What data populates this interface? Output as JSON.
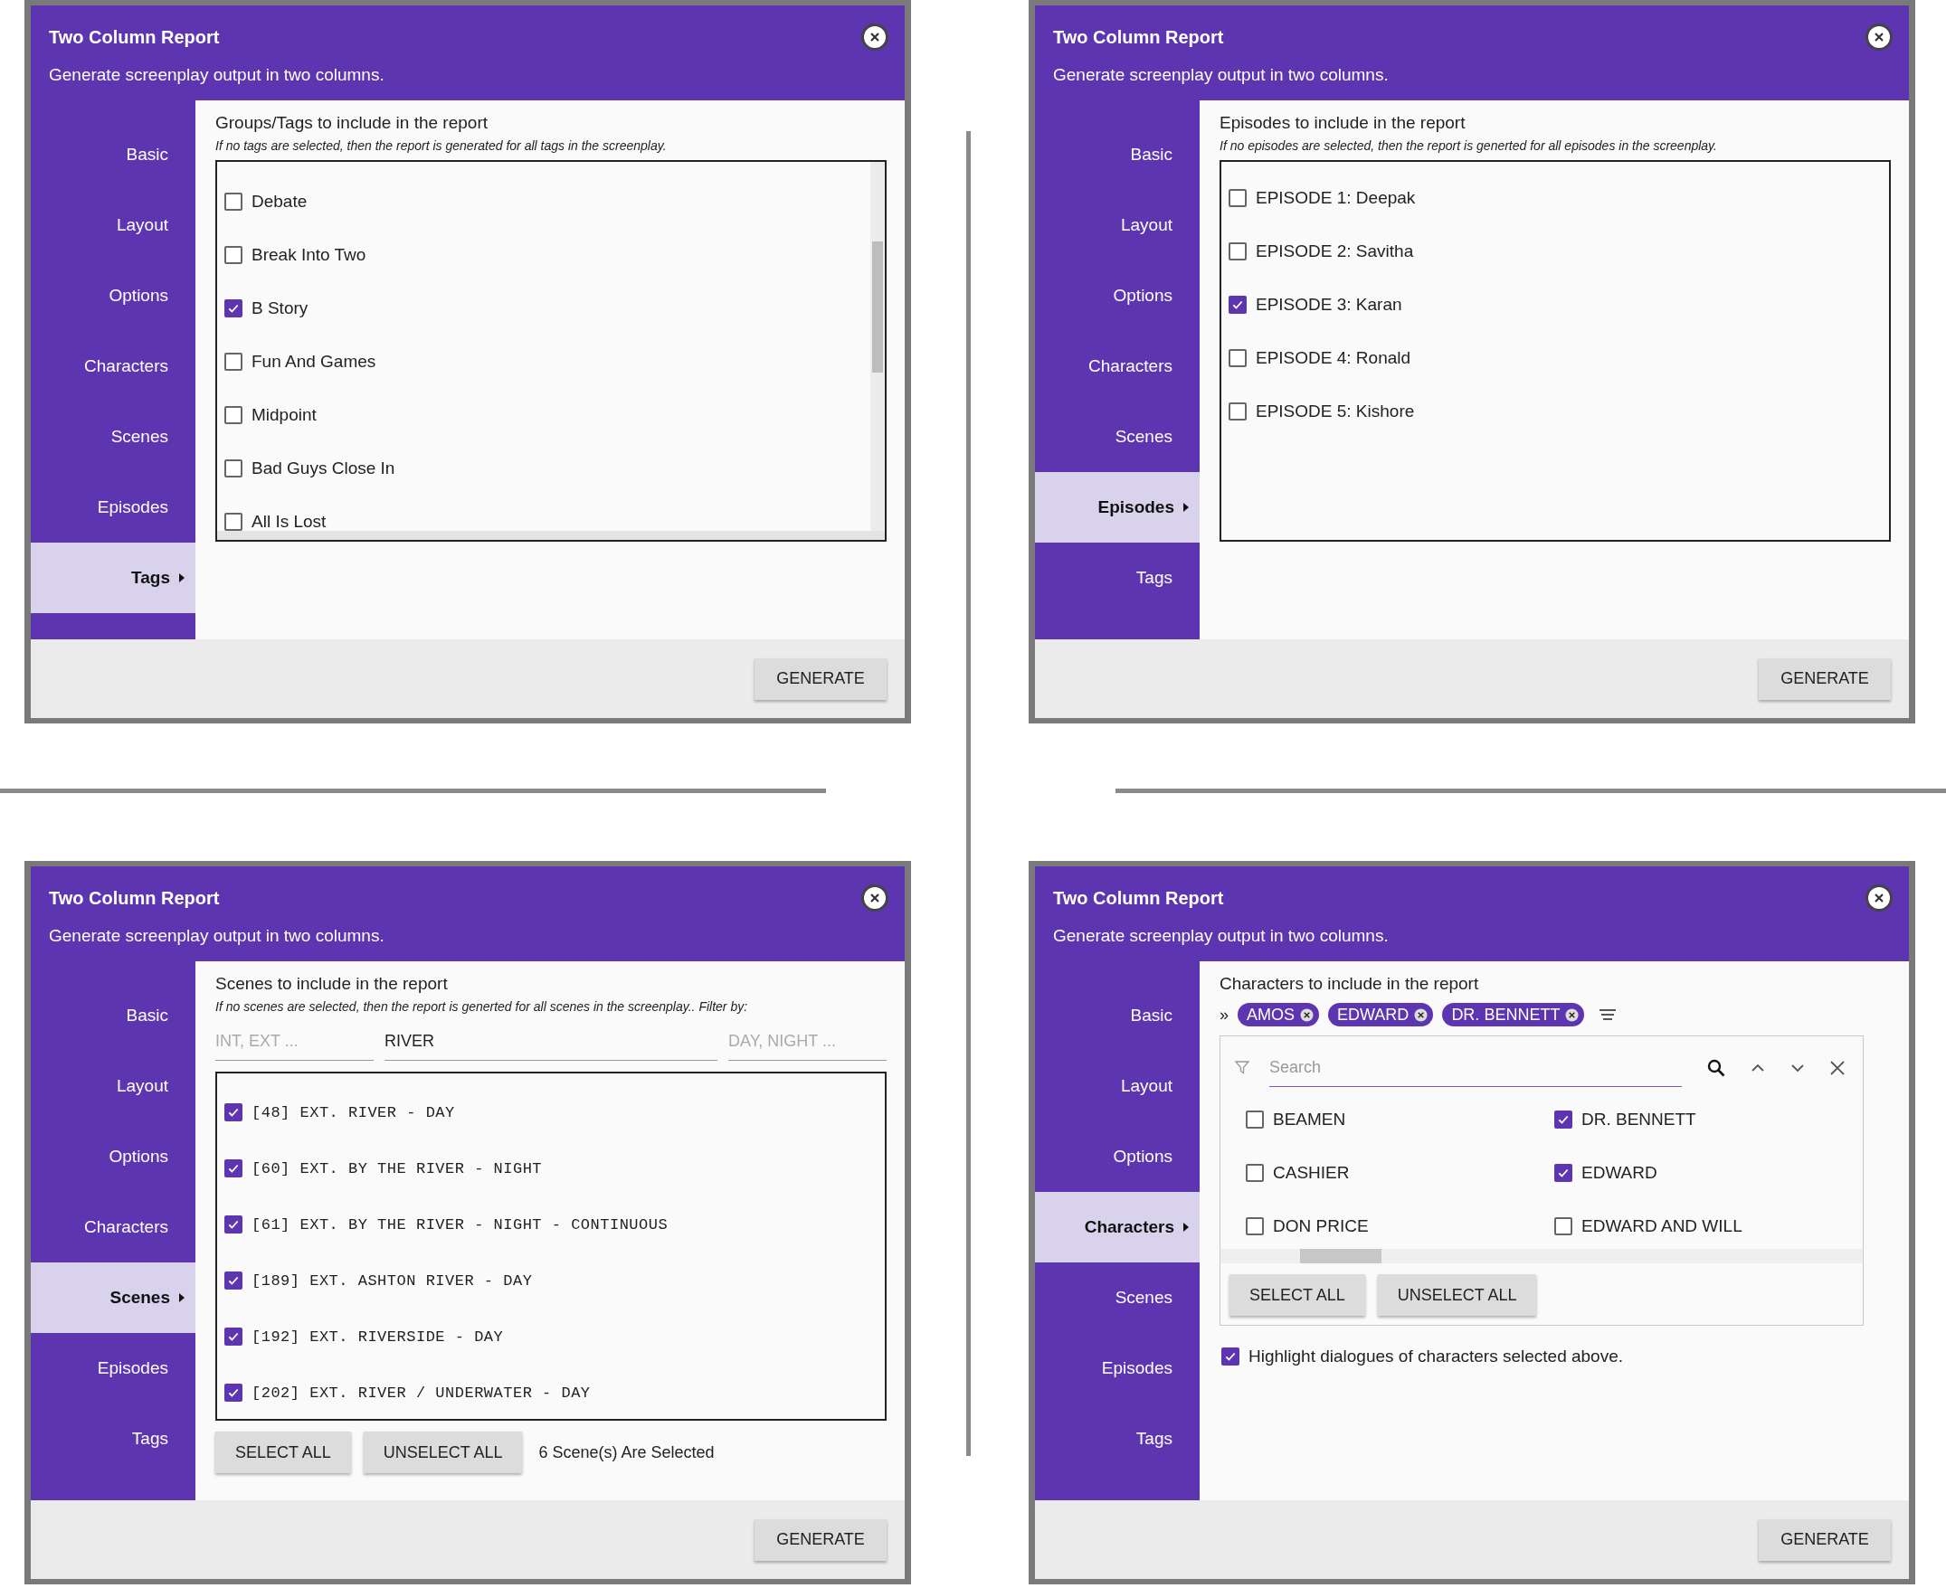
{
  "dialogs": [
    {
      "title": "Two Column Report",
      "subtitle": "Generate screenplay output in two columns.",
      "nav": [
        {
          "label": "Basic",
          "selected": false
        },
        {
          "label": "Layout",
          "selected": false
        },
        {
          "label": "Options",
          "selected": false
        },
        {
          "label": "Characters",
          "selected": false
        },
        {
          "label": "Scenes",
          "selected": false
        },
        {
          "label": "Episodes",
          "selected": false
        },
        {
          "label": "Tags",
          "selected": true
        }
      ],
      "panel": {
        "kind": "checklist",
        "scrollable": true,
        "heading": "Groups/Tags to include in the report",
        "note": "If no tags are selected, then the report is generated for all tags in the screenplay.",
        "items": [
          {
            "label": "Debate",
            "checked": false
          },
          {
            "label": "Break Into Two",
            "checked": false
          },
          {
            "label": "B Story",
            "checked": true
          },
          {
            "label": "Fun And Games",
            "checked": false
          },
          {
            "label": "Midpoint",
            "checked": false
          },
          {
            "label": "Bad Guys Close In",
            "checked": false
          },
          {
            "label": "All Is Lost",
            "checked": false
          }
        ]
      },
      "generate_button": "GENERATE"
    },
    {
      "title": "Two Column Report",
      "subtitle": "Generate screenplay output in two columns.",
      "nav": [
        {
          "label": "Basic",
          "selected": false
        },
        {
          "label": "Layout",
          "selected": false
        },
        {
          "label": "Options",
          "selected": false
        },
        {
          "label": "Characters",
          "selected": false
        },
        {
          "label": "Scenes",
          "selected": false
        },
        {
          "label": "Episodes",
          "selected": true
        },
        {
          "label": "Tags",
          "selected": false
        }
      ],
      "panel": {
        "kind": "checklist",
        "scrollable": false,
        "heading": "Episodes to include in the report",
        "note": "If no episodes are selected, then the report is generted for all episodes in the screenplay.",
        "items": [
          {
            "label": "EPISODE 1: Deepak",
            "checked": false
          },
          {
            "label": "EPISODE 2: Savitha",
            "checked": false
          },
          {
            "label": "EPISODE 3: Karan",
            "checked": true
          },
          {
            "label": "EPISODE 4: Ronald",
            "checked": false
          },
          {
            "label": "EPISODE 5: Kishore",
            "checked": false
          }
        ]
      },
      "generate_button": "GENERATE"
    },
    {
      "title": "Two Column Report",
      "subtitle": "Generate screenplay output in two columns.",
      "nav": [
        {
          "label": "Basic",
          "selected": false
        },
        {
          "label": "Layout",
          "selected": false
        },
        {
          "label": "Options",
          "selected": false
        },
        {
          "label": "Characters",
          "selected": false
        },
        {
          "label": "Scenes",
          "selected": true
        },
        {
          "label": "Episodes",
          "selected": false
        },
        {
          "label": "Tags",
          "selected": false
        }
      ],
      "panel": {
        "kind": "scenes",
        "heading": "Scenes to include in the report",
        "note": "If no scenes are selected, then the report is generted for all scenes in the screenplay.. Filter by:",
        "filters": [
          {
            "placeholder": "INT, EXT ..."
          },
          {
            "value": "RIVER"
          },
          {
            "placeholder": "DAY, NIGHT ..."
          }
        ],
        "items": [
          {
            "label": "[48] EXT. RIVER - DAY",
            "checked": true
          },
          {
            "label": "[60] EXT. BY THE RIVER - NIGHT",
            "checked": true
          },
          {
            "label": "[61] EXT. BY THE RIVER - NIGHT - CONTINUOUS",
            "checked": true
          },
          {
            "label": "[189] EXT. ASHTON RIVER - DAY",
            "checked": true
          },
          {
            "label": "[192] EXT. RIVERSIDE - DAY",
            "checked": true
          },
          {
            "label": "[202] EXT. RIVER / UNDERWATER - DAY",
            "checked": true
          }
        ],
        "buttons": [
          "SELECT ALL",
          "UNSELECT ALL"
        ],
        "summary": "6 Scene(s) Are Selected"
      },
      "generate_button": "GENERATE"
    },
    {
      "title": "Two Column Report",
      "subtitle": "Generate screenplay output in two columns.",
      "nav": [
        {
          "label": "Basic",
          "selected": false
        },
        {
          "label": "Layout",
          "selected": false
        },
        {
          "label": "Options",
          "selected": false
        },
        {
          "label": "Characters",
          "selected": true
        },
        {
          "label": "Scenes",
          "selected": false
        },
        {
          "label": "Episodes",
          "selected": false
        },
        {
          "label": "Tags",
          "selected": false
        }
      ],
      "panel": {
        "kind": "characters",
        "heading": "Characters to include in the report",
        "chips_prefix": "»",
        "chips": [
          "AMOS",
          "EDWARD",
          "DR. BENNETT"
        ],
        "search": {
          "placeholder": "Search"
        },
        "items": [
          {
            "label": "BEAMEN",
            "checked": false
          },
          {
            "label": "DR. BENNETT",
            "checked": true
          },
          {
            "label": "CASHIER",
            "checked": false
          },
          {
            "label": "EDWARD",
            "checked": true
          },
          {
            "label": "DON PRICE",
            "checked": false
          },
          {
            "label": "EDWARD AND WILL",
            "checked": false
          }
        ],
        "buttons": [
          "SELECT ALL",
          "UNSELECT ALL"
        ],
        "option": {
          "label": "Highlight dialogues of characters selected above.",
          "checked": true
        }
      },
      "generate_button": "GENERATE"
    }
  ]
}
